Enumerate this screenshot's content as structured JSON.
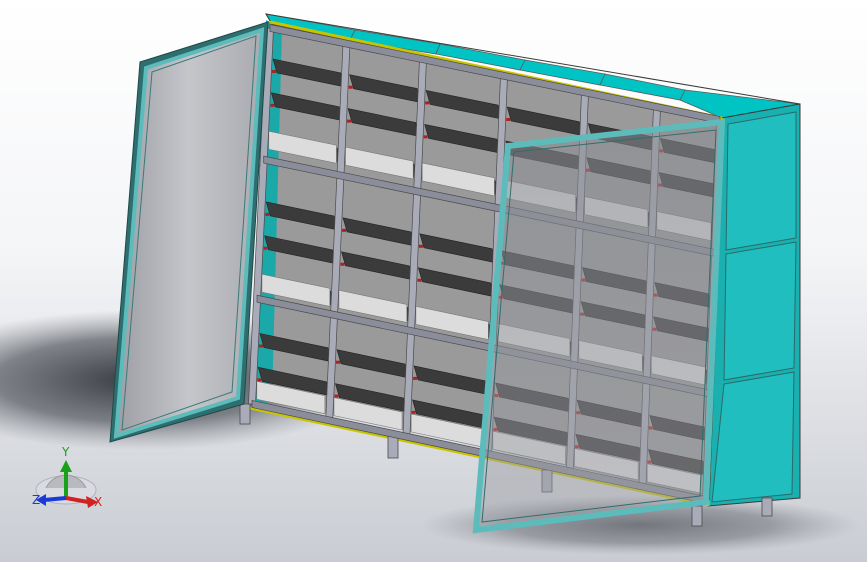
{
  "viewport": {
    "background_top": "#ffffff",
    "background_bottom": "#c9ccd2",
    "shadow": "#2e3238"
  },
  "model": {
    "frame_color": "#00c4c4",
    "frame_side_color": "#1a9a9a",
    "post_color": "#a9acb8",
    "post_dark": "#8b8e9a",
    "shelf_dark": "#3b3b3b",
    "shelf_light": "#dcdcdc",
    "interior": "#9a9a9a",
    "gasket": "#c9c400",
    "glass": "#8c8e94",
    "door_frame": "#5cbcbc",
    "connector": "#b02020"
  },
  "triad": {
    "x_label": "X",
    "y_label": "Y",
    "z_label": "Z",
    "x_color": "#d32020",
    "y_color": "#1aa01a",
    "z_color": "#1a3ad8"
  }
}
